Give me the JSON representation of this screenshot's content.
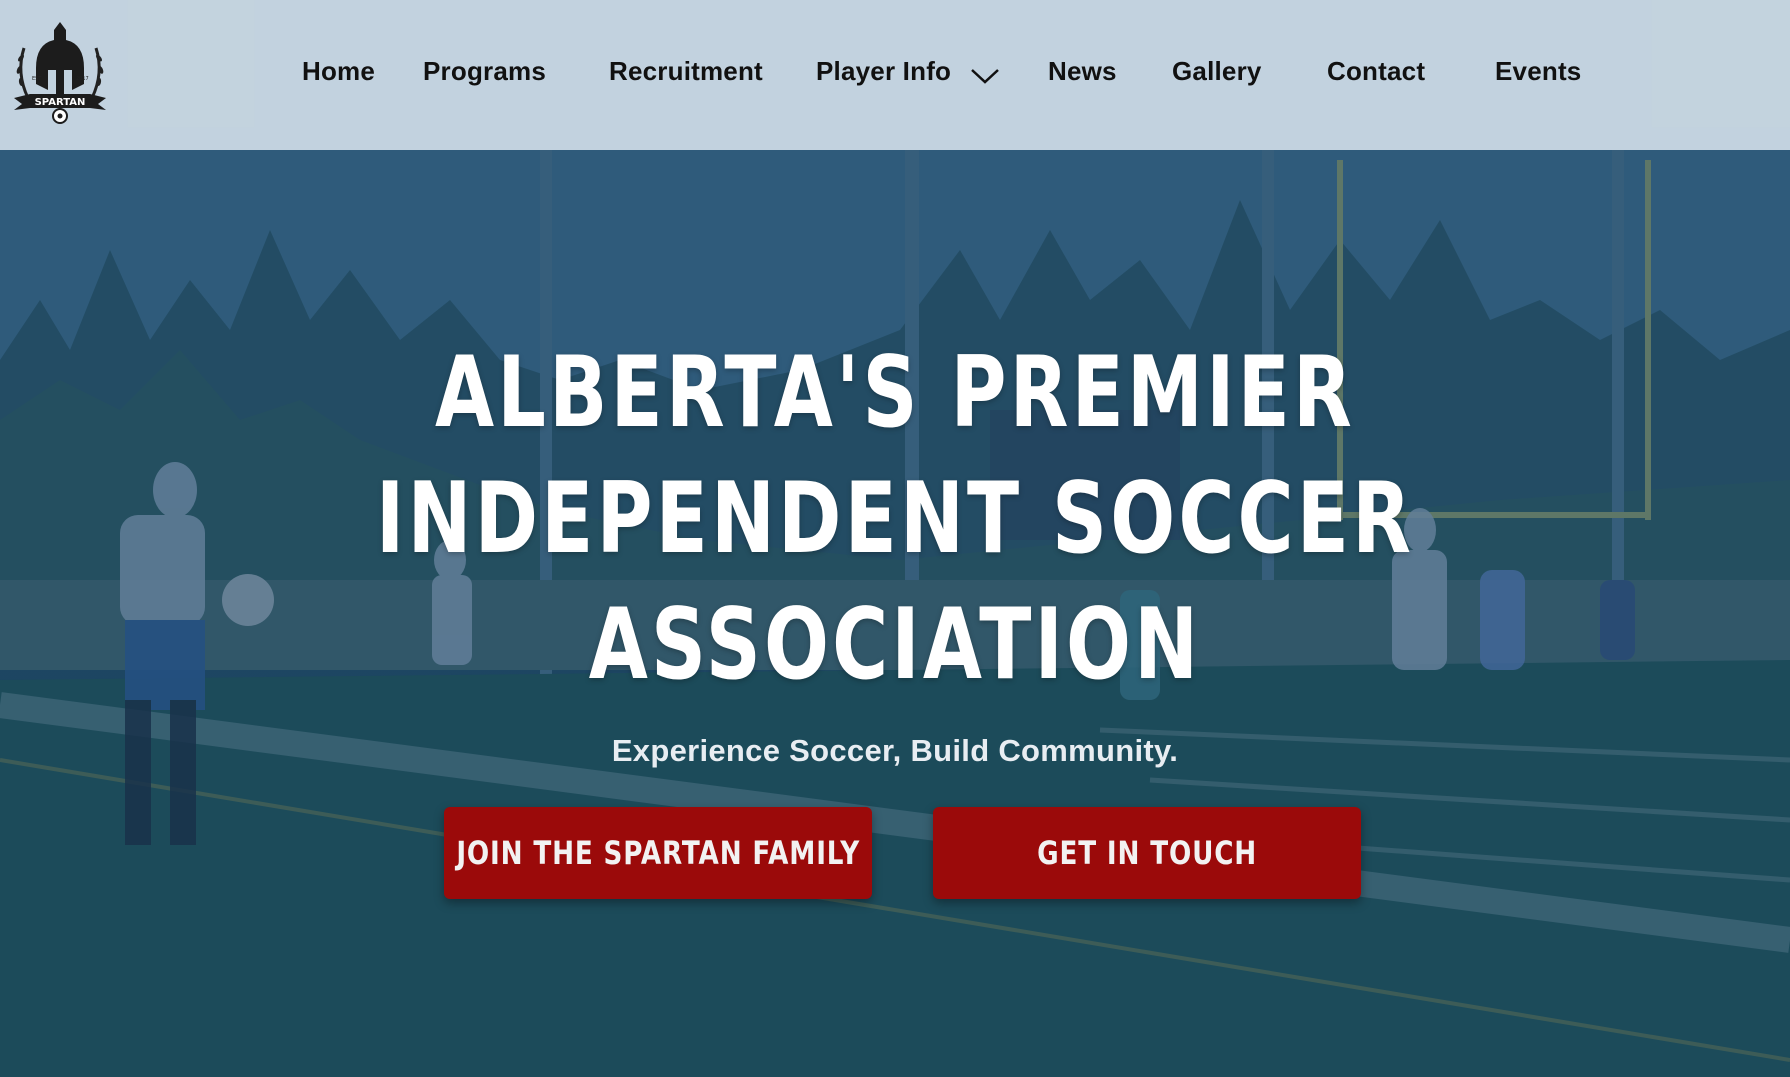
{
  "brand": {
    "logo_text": "SPARTAN",
    "logo_est_left": "EST",
    "logo_est_right": "2017"
  },
  "nav": {
    "items": [
      {
        "label": "Home"
      },
      {
        "label": "Programs"
      },
      {
        "label": "Recruitment"
      },
      {
        "label": "Player Info",
        "has_dropdown": true
      },
      {
        "label": "News"
      },
      {
        "label": "Gallery"
      },
      {
        "label": "Contact"
      },
      {
        "label": "Events"
      }
    ]
  },
  "hero": {
    "headline_lines": [
      "ALBERTA'S PREMIER",
      "INDEPENDENT SOCCER",
      "ASSOCIATION"
    ],
    "tagline": "Experience Soccer, Build Community.",
    "primary_button": "JOIN THE SPARTAN FAMILY",
    "secondary_button": "GET IN TOUCH"
  },
  "colors": {
    "nav_bg": "#cedce6",
    "overlay": "#184066",
    "button_red": "#9b0a0a",
    "text_dark": "#111111",
    "text_light": "#ffffff"
  },
  "icons": {
    "logo": "spartan-helmet-logo",
    "dropdown": "chevron-down-icon"
  }
}
